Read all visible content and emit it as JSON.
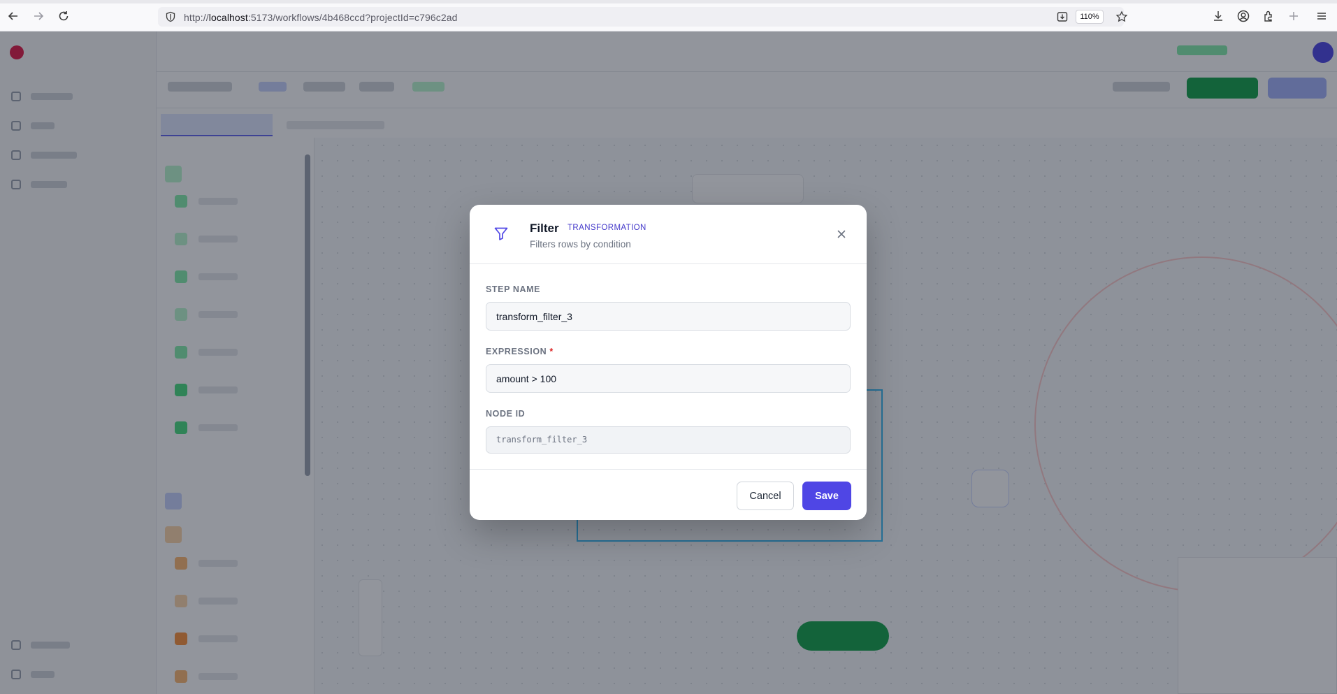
{
  "browser": {
    "url_prefix": "http://",
    "url_host": "localhost",
    "url_path": ":5173/workflows/4b468ccd?projectId=c796c2ad",
    "zoom_level": "110%"
  },
  "modal": {
    "icon": "filter-icon",
    "title": "Filter",
    "badge": "TRANSFORMATION",
    "subtitle": "Filters rows by condition",
    "fields": {
      "step_name": {
        "label": "STEP NAME",
        "value": "transform_filter_3"
      },
      "expression": {
        "label": "EXPRESSION",
        "required_mark": "*",
        "value": "amount > 100"
      },
      "node_id": {
        "label": "NODE ID",
        "value": "transform_filter_3"
      }
    },
    "footer": {
      "cancel_label": "Cancel",
      "save_label": "Save"
    }
  },
  "colors": {
    "accent": "#4f46e5",
    "badge": "#4338ca",
    "required": "#dc2626"
  }
}
